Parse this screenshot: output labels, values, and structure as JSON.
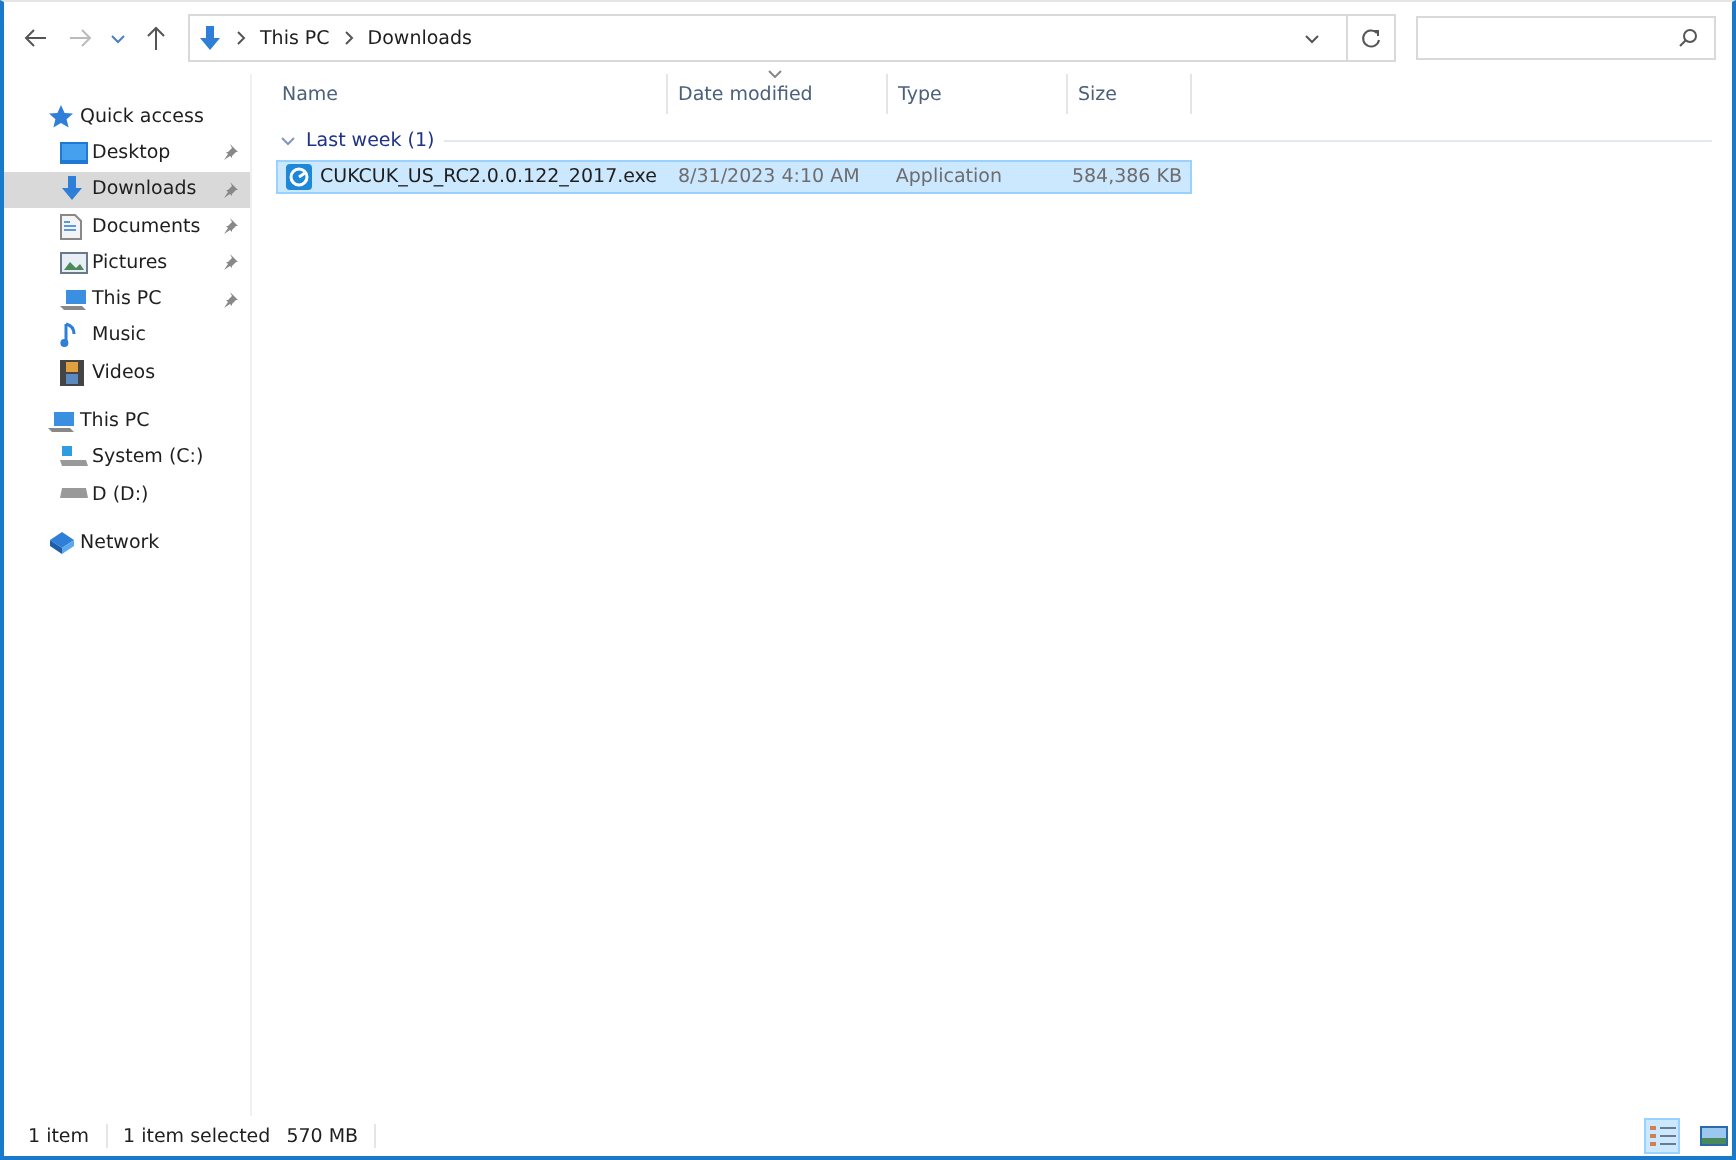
{
  "address_bar": {
    "path": [
      "This PC",
      "Downloads"
    ]
  },
  "sidebar": {
    "items": [
      {
        "label": "Quick access",
        "kind": "star",
        "selected": false,
        "children": [
          {
            "label": "Desktop",
            "kind": "desktop",
            "pinned": true,
            "selected": false
          },
          {
            "label": "Downloads",
            "kind": "download",
            "pinned": true,
            "selected": true
          },
          {
            "label": "Documents",
            "kind": "document",
            "pinned": true,
            "selected": false
          },
          {
            "label": "Pictures",
            "kind": "pictures",
            "pinned": true,
            "selected": false
          },
          {
            "label": "This PC",
            "kind": "pc",
            "pinned": true,
            "selected": false
          },
          {
            "label": "Music",
            "kind": "music",
            "pinned": false,
            "selected": false
          },
          {
            "label": "Videos",
            "kind": "video",
            "pinned": false,
            "selected": false
          }
        ]
      },
      {
        "label": "This PC",
        "kind": "pc",
        "selected": false,
        "children": [
          {
            "label": "System (C:)",
            "kind": "sysdrive",
            "selected": false
          },
          {
            "label": "D (D:)",
            "kind": "drive",
            "selected": false
          }
        ]
      },
      {
        "label": "Network",
        "kind": "network",
        "selected": false
      }
    ]
  },
  "table": {
    "columns": [
      {
        "label": "Name",
        "sorted": false
      },
      {
        "label": "Date modified",
        "sorted": true
      },
      {
        "label": "Type",
        "sorted": false
      },
      {
        "label": "Size",
        "sorted": false
      }
    ],
    "groups": [
      {
        "label": "Last week (1)",
        "expanded": true,
        "rows": [
          {
            "name": "CUKCUK_US_RC2.0.0.122_2017.exe",
            "date": "8/31/2023 4:10 AM",
            "type": "Application",
            "size": "584,386 KB",
            "selected": true
          }
        ]
      }
    ]
  },
  "status_bar": {
    "count": "1 item",
    "selection": "1 item selected",
    "size": "570 MB",
    "views": [
      {
        "kind": "details",
        "selected": true
      },
      {
        "kind": "large",
        "selected": false
      }
    ]
  }
}
